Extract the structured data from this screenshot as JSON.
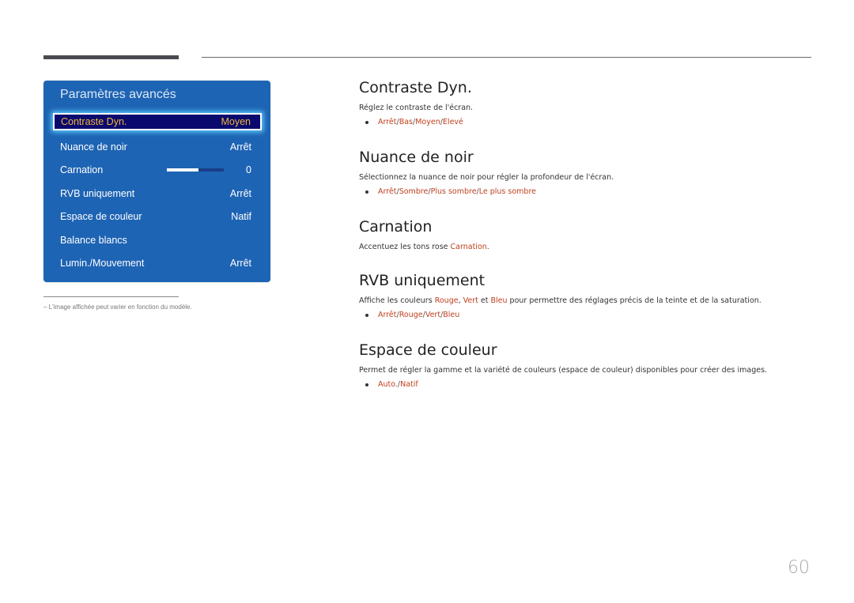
{
  "osd": {
    "title": "Paramètres avancés",
    "selected": {
      "label": "Contraste Dyn.",
      "value": "Moyen"
    },
    "items": [
      {
        "label": "Nuance de noir",
        "value": "Arrêt"
      },
      {
        "label": "Carnation",
        "value": "0",
        "slider_fill": 0.55
      },
      {
        "label": "RVB uniquement",
        "value": "Arrêt"
      },
      {
        "label": "Espace de couleur",
        "value": "Natif"
      },
      {
        "label": "Balance blancs",
        "value": ""
      },
      {
        "label": "Lumin./Mouvement",
        "value": "Arrêt"
      }
    ],
    "colors": {
      "panel": "#1e64b4",
      "selected_bg": "#0a0a6e",
      "selected_text": "#f0b43c",
      "glow": "#5fd0ff"
    }
  },
  "note": "–  L'image affichée peut varier en fonction du modèle.",
  "sections": {
    "contraste": {
      "title": "Contraste Dyn.",
      "desc": "Réglez le contraste de l'écran.",
      "options": [
        "Arrêt",
        "Bas",
        "Moyen",
        "Elevé"
      ]
    },
    "nuance": {
      "title": "Nuance de noir",
      "desc": "Sélectionnez la nuance de noir pour régler la profondeur de l'écran.",
      "options": [
        "Arrêt",
        "Sombre",
        "Plus sombre",
        "Le plus sombre"
      ]
    },
    "carnation": {
      "title": "Carnation",
      "desc_prefix": "Accentuez les tons rose ",
      "desc_highlight": "Carnation",
      "desc_suffix": "."
    },
    "rvb": {
      "title": "RVB uniquement",
      "desc_prefix": "Affiche les couleurs ",
      "hl1": "Rouge",
      "mid1": ", ",
      "hl2": "Vert",
      "mid2": " et ",
      "hl3": "Bleu",
      "desc_suffix": " pour permettre des réglages précis de la teinte et de la saturation.",
      "options": [
        "Arrêt",
        "Rouge",
        "Vert",
        "Bleu"
      ]
    },
    "espace": {
      "title": "Espace de couleur",
      "desc": "Permet de régler la gamme et la variété de couleurs (espace de couleur) disponibles pour créer des images.",
      "options": [
        "Auto.",
        "Natif"
      ]
    }
  },
  "separator": " / ",
  "page_number": "60",
  "accent_color": "#c0401e"
}
